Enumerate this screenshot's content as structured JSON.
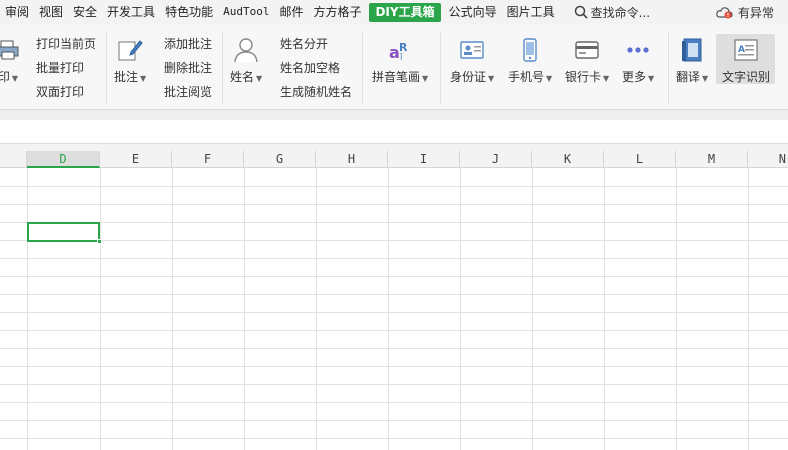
{
  "menubar": {
    "items": [
      "审阅",
      "视图",
      "安全",
      "开发工具",
      "特色功能",
      "AudTool",
      "邮件",
      "方方格子",
      "DIY工具箱",
      "公式向导",
      "图片工具"
    ],
    "search_label": "查找命令...",
    "status_label": "有异常"
  },
  "ribbon": {
    "print_big": "印",
    "print_current": "打印当前页",
    "batch_print": "批量打印",
    "duplex_print": "双面打印",
    "comment_big": "批注",
    "add_comment": "添加批注",
    "delete_comment": "删除批注",
    "view_comment": "批注阅览",
    "name_big": "姓名",
    "split_name": "姓名分开",
    "name_add_space": "姓名加空格",
    "random_name": "生成随机姓名",
    "pinyin": "拼音笔画",
    "id_card": "身份证",
    "phone": "手机号",
    "bank_card": "银行卡",
    "more": "更多",
    "translate": "翻译",
    "ocr": "文字识别"
  },
  "grid": {
    "columns": [
      "D",
      "E",
      "F",
      "G",
      "H",
      "I",
      "J",
      "K",
      "L",
      "M",
      "N"
    ],
    "selected_column": "D"
  },
  "colors": {
    "accent": "#2aa549",
    "menubar_bg": "#f3f3f3",
    "ribbon_bg": "#f7f7f7",
    "gridline": "#e2e2e2"
  }
}
